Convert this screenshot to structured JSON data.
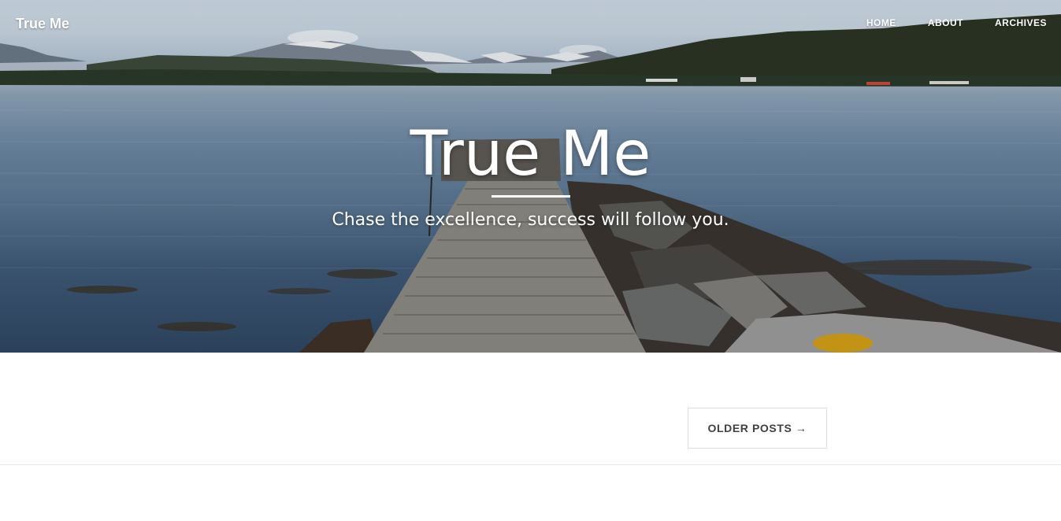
{
  "brand": "True Me",
  "nav": {
    "home": "HOME",
    "about": "ABOUT",
    "archives": "ARCHIVES"
  },
  "hero": {
    "title": "True Me",
    "subtitle": "Chase the excellence, success will follow you."
  },
  "pager": {
    "older_label": "OLDER POSTS →"
  }
}
